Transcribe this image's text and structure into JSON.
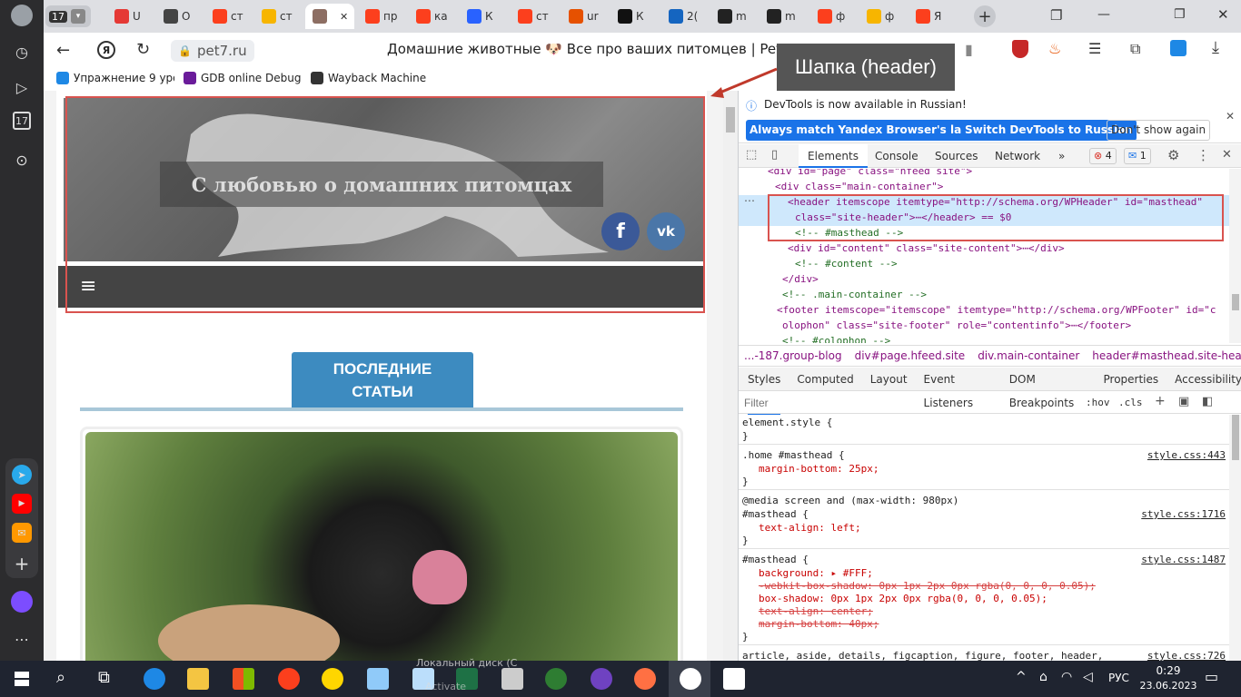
{
  "rail": {
    "badge": "17"
  },
  "tabs": {
    "counter": "17",
    "items": [
      {
        "label": "U",
        "color": "#e53935"
      },
      {
        "label": "O",
        "color": "#444"
      },
      {
        "label": "ст",
        "color": "#fc3f1d"
      },
      {
        "label": "ст",
        "color": "#f7b500"
      },
      {
        "label": "",
        "color": "#8d6e63"
      },
      {
        "label": "пр",
        "color": "#fc3f1d"
      },
      {
        "label": "ка",
        "color": "#fc3f1d"
      },
      {
        "label": "К",
        "color": "#2962ff"
      },
      {
        "label": "ст",
        "color": "#fc3f1d"
      },
      {
        "label": "ur",
        "color": "#e65100"
      },
      {
        "label": "К",
        "color": "#111"
      },
      {
        "label": "2(",
        "color": "#1565c0"
      },
      {
        "label": "m",
        "color": "#222"
      },
      {
        "label": "m",
        "color": "#222"
      },
      {
        "label": "ф",
        "color": "#fc3f1d"
      },
      {
        "label": "ф",
        "color": "#f7b500"
      },
      {
        "label": "Я",
        "color": "#fc3f1d"
      }
    ],
    "close_glyph": "✕",
    "new_tab": "+"
  },
  "address": {
    "domain": "pet7.ru",
    "title": "Домашние животные 🐶 Все про ваших питомцев | Pet7"
  },
  "bookmarks": [
    {
      "label": "Упражнение 9 урок",
      "color": "#1e88e5"
    },
    {
      "label": "GDB online Debugg...",
      "color": "#6a1b9a"
    },
    {
      "label": "Wayback Machine",
      "color": "#333"
    }
  ],
  "callout": "Шапка (header)",
  "site": {
    "banner_title": "С любовью о домашних питомцах",
    "social": [
      "f",
      "vk"
    ],
    "menu_icon": "≡",
    "section_label": "ПОСЛЕДНИЕ СТАТЬИ"
  },
  "devtools": {
    "notice": "DevTools is now available in Russian!",
    "btn_match": "Always match Yandex Browser's language",
    "btn_switch": "Switch DevTools to Russian",
    "btn_dont": "Don't show again",
    "tabs": [
      "Elements",
      "Console",
      "Sources",
      "Network",
      "»"
    ],
    "errors": "4",
    "messages": "1",
    "dom_lines": [
      "<div id=\"page\" class=\"hfeed site\">",
      "<div class=\"main-container\">",
      "<header itemscope itemtype=\"http://schema.org/WPHeader\" id=\"masthead\"",
      "class=\"site-header\">⋯</header> == $0",
      "<!-- #masthead -->",
      "<div id=\"content\" class=\"site-content\">⋯</div>",
      "<!-- #content -->",
      "</div>",
      "<!-- .main-container -->",
      "<footer itemscope=\"itemscope\" itemtype=\"http://schema.org/WPFooter\" id=\"c",
      "olophon\" class=\"site-footer\" role=\"contentinfo\">⋯</footer>",
      "<!-- #colophon -->"
    ],
    "breadcrumbs": [
      "...-187.group-blog",
      "div#page.hfeed.site",
      "div.main-container",
      "header#masthead.site-header"
    ],
    "style_tabs": [
      "Styles",
      "Computed",
      "Layout",
      "Event Listeners",
      "DOM Breakpoints",
      "Properties",
      "Accessibility"
    ],
    "filter_placeholder": "Filter",
    "hov": ":hov",
    "cls": ".cls",
    "rules": [
      {
        "selector": "element.style {",
        "props": [],
        "source": ""
      },
      {
        "selector": ".home #masthead {",
        "props": [
          "margin-bottom: 25px;"
        ],
        "source": "style.css:443"
      },
      {
        "media": "@media screen and (max-width: 980px)",
        "selector": "#masthead {",
        "props": [
          "text-align: left;"
        ],
        "source": "style.css:1716"
      },
      {
        "selector": "#masthead {",
        "props": [
          "background: ▸ #FFF;",
          "-webkit-box-shadow: 0px 1px 2px 0px rgba(0, 0, 0, 0.05);",
          "box-shadow: 0px 1px 2px 0px rgba(0, 0, 0, 0.05);",
          "text-align: center;",
          "margin-bottom: 40px;"
        ],
        "source": "style.css:1487"
      },
      {
        "selector": "article, aside, details, figcaption, figure, footer, header,",
        "props": [],
        "source": "style.css:726"
      }
    ]
  },
  "taskbar": {
    "overlay_text": "Локальный диск (C",
    "overlay_text2": "Activate",
    "lang": "РУС",
    "time": "0:29",
    "date": "23.06.2023"
  }
}
